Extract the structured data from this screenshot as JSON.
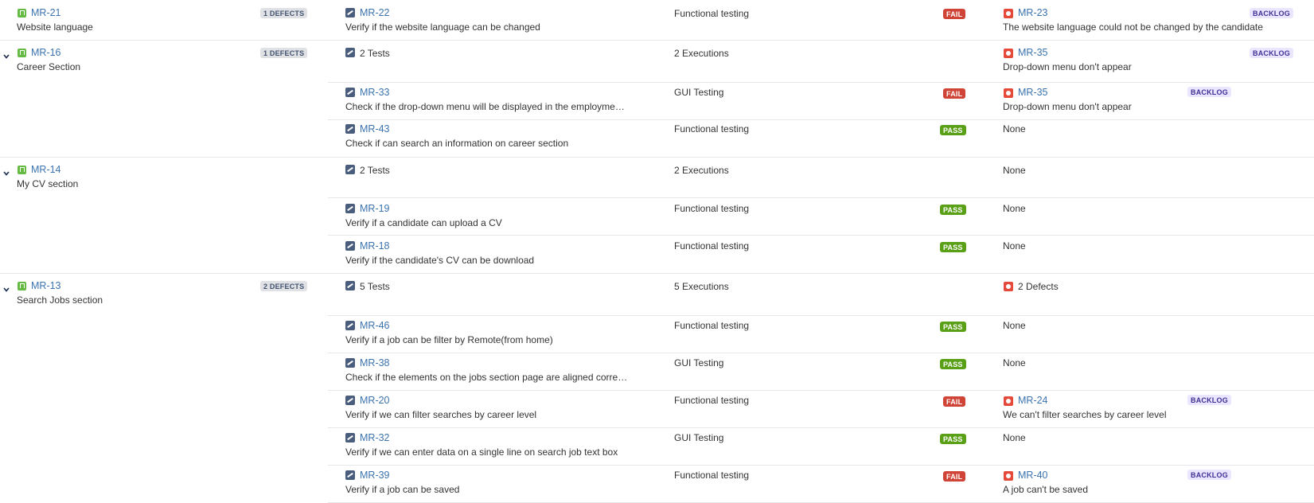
{
  "colors": {
    "link": "#3b73af",
    "fail": "#d04437",
    "pass": "#5aa017",
    "backlog_bg": "#eae6ff",
    "story": "#65ba43",
    "bug": "#e5493a",
    "test": "#4a5d7d"
  },
  "rows": [
    {
      "story_key": "MR-21",
      "story_summary": "Website language",
      "story_defects": "1 DEFECTS",
      "test_key": "MR-22",
      "test_summary": "Verify if the website language can be changed",
      "test_type": "Functional testing",
      "status": "FAIL",
      "defect_key": "MR-23",
      "defect_summary": "The website language could not be changed by the candidate",
      "defect_status": "BACKLOG"
    },
    {
      "story_key": "MR-16",
      "story_summary": "Career Section",
      "story_defects": "1 DEFECTS",
      "tests_summary": "2 Tests",
      "executions_summary": "2 Executions",
      "defect_key": "MR-35",
      "defect_summary": "Drop-down menu don't appear",
      "defect_status": "BACKLOG",
      "children": [
        {
          "test_key": "MR-33",
          "test_summary": "Check if the drop-down menu will be displayed in the employme…",
          "test_type": "GUI Testing",
          "status": "FAIL",
          "defect_key": "MR-35",
          "defect_summary": "Drop-down menu don't appear",
          "defect_status": "BACKLOG"
        },
        {
          "test_key": "MR-43",
          "test_summary": "Check if can search an information on career section",
          "test_type": "Functional testing",
          "status": "PASS",
          "defect_none": "None"
        }
      ]
    },
    {
      "story_key": "MR-14",
      "story_summary": "My CV section",
      "tests_summary": "2 Tests",
      "executions_summary": "2 Executions",
      "defect_none": "None",
      "children": [
        {
          "test_key": "MR-19",
          "test_summary": "Verify if a candidate can upload a CV",
          "test_type": "Functional testing",
          "status": "PASS",
          "defect_none": "None"
        },
        {
          "test_key": "MR-18",
          "test_summary": "Verify if the candidate's CV can be download",
          "test_type": "Functional testing",
          "status": "PASS",
          "defect_none": "None"
        }
      ]
    },
    {
      "story_key": "MR-13",
      "story_summary": "Search Jobs section",
      "story_defects": "2 DEFECTS",
      "tests_summary": "5 Tests",
      "executions_summary": "5 Executions",
      "defects_summary": "2 Defects",
      "children": [
        {
          "test_key": "MR-46",
          "test_summary": "Verify if a job can be filter by Remote(from home)",
          "test_type": "Functional testing",
          "status": "PASS",
          "defect_none": "None"
        },
        {
          "test_key": "MR-38",
          "test_summary": "Check if the elements on the jobs section page are aligned corre…",
          "test_type": "GUI Testing",
          "status": "PASS",
          "defect_none": "None"
        },
        {
          "test_key": "MR-20",
          "test_summary": "Verify if we can filter searches by career level",
          "test_type": "Functional testing",
          "status": "FAIL",
          "defect_key": "MR-24",
          "defect_summary": "We can't filter searches by career level",
          "defect_status": "BACKLOG"
        },
        {
          "test_key": "MR-32",
          "test_summary": "Verify if we can enter data on a single line on search job text box",
          "test_type": "GUI Testing",
          "status": "PASS",
          "defect_none": "None"
        },
        {
          "test_key": "MR-39",
          "test_summary": "Verify if a job can be saved",
          "test_type": "Functional testing",
          "status": "FAIL",
          "defect_key": "MR-40",
          "defect_summary": "A job can't be saved",
          "defect_status": "BACKLOG"
        }
      ]
    }
  ]
}
